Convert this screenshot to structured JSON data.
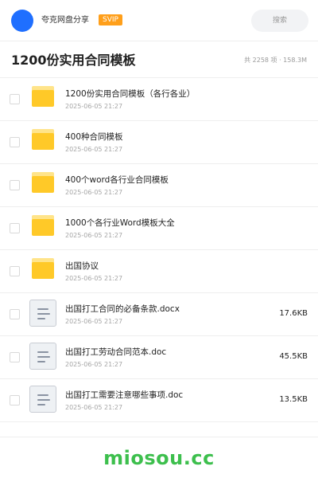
{
  "topbar": {
    "brand": "夸克网盘分享",
    "badge": "SVIP",
    "search_label": "搜索"
  },
  "header": {
    "title": "1200份实用合同模板",
    "meta": "共 2258 项 · 158.3M"
  },
  "files": [
    {
      "type": "folder",
      "name": "1200份实用合同模板（各行各业）",
      "date": "2025-06-05 21:27",
      "size": ""
    },
    {
      "type": "folder",
      "name": "400种合同模板",
      "date": "2025-06-05 21:27",
      "size": ""
    },
    {
      "type": "folder",
      "name": "400个word各行业合同模板",
      "date": "2025-06-05 21:27",
      "size": ""
    },
    {
      "type": "folder",
      "name": "1000个各行业Word模板大全",
      "date": "2025-06-05 21:27",
      "size": ""
    },
    {
      "type": "folder",
      "name": "出国协议",
      "date": "2025-06-05 21:27",
      "size": ""
    },
    {
      "type": "doc",
      "name": "出国打工合同的必备条款.docx",
      "date": "2025-06-05 21:27",
      "size": "17.6KB"
    },
    {
      "type": "doc",
      "name": "出国打工劳动合同范本.doc",
      "date": "2025-06-05 21:27",
      "size": "45.5KB"
    },
    {
      "type": "doc",
      "name": "出国打工需要注意哪些事项.doc",
      "date": "2025-06-05 21:27",
      "size": "13.5KB"
    }
  ],
  "footer": {
    "watermark": "miosou.cc"
  },
  "colors": {
    "accent": "#1f6fff",
    "badge": "#ff9f1a",
    "folder": "#ffc928",
    "watermark": "#3dbf4d"
  }
}
